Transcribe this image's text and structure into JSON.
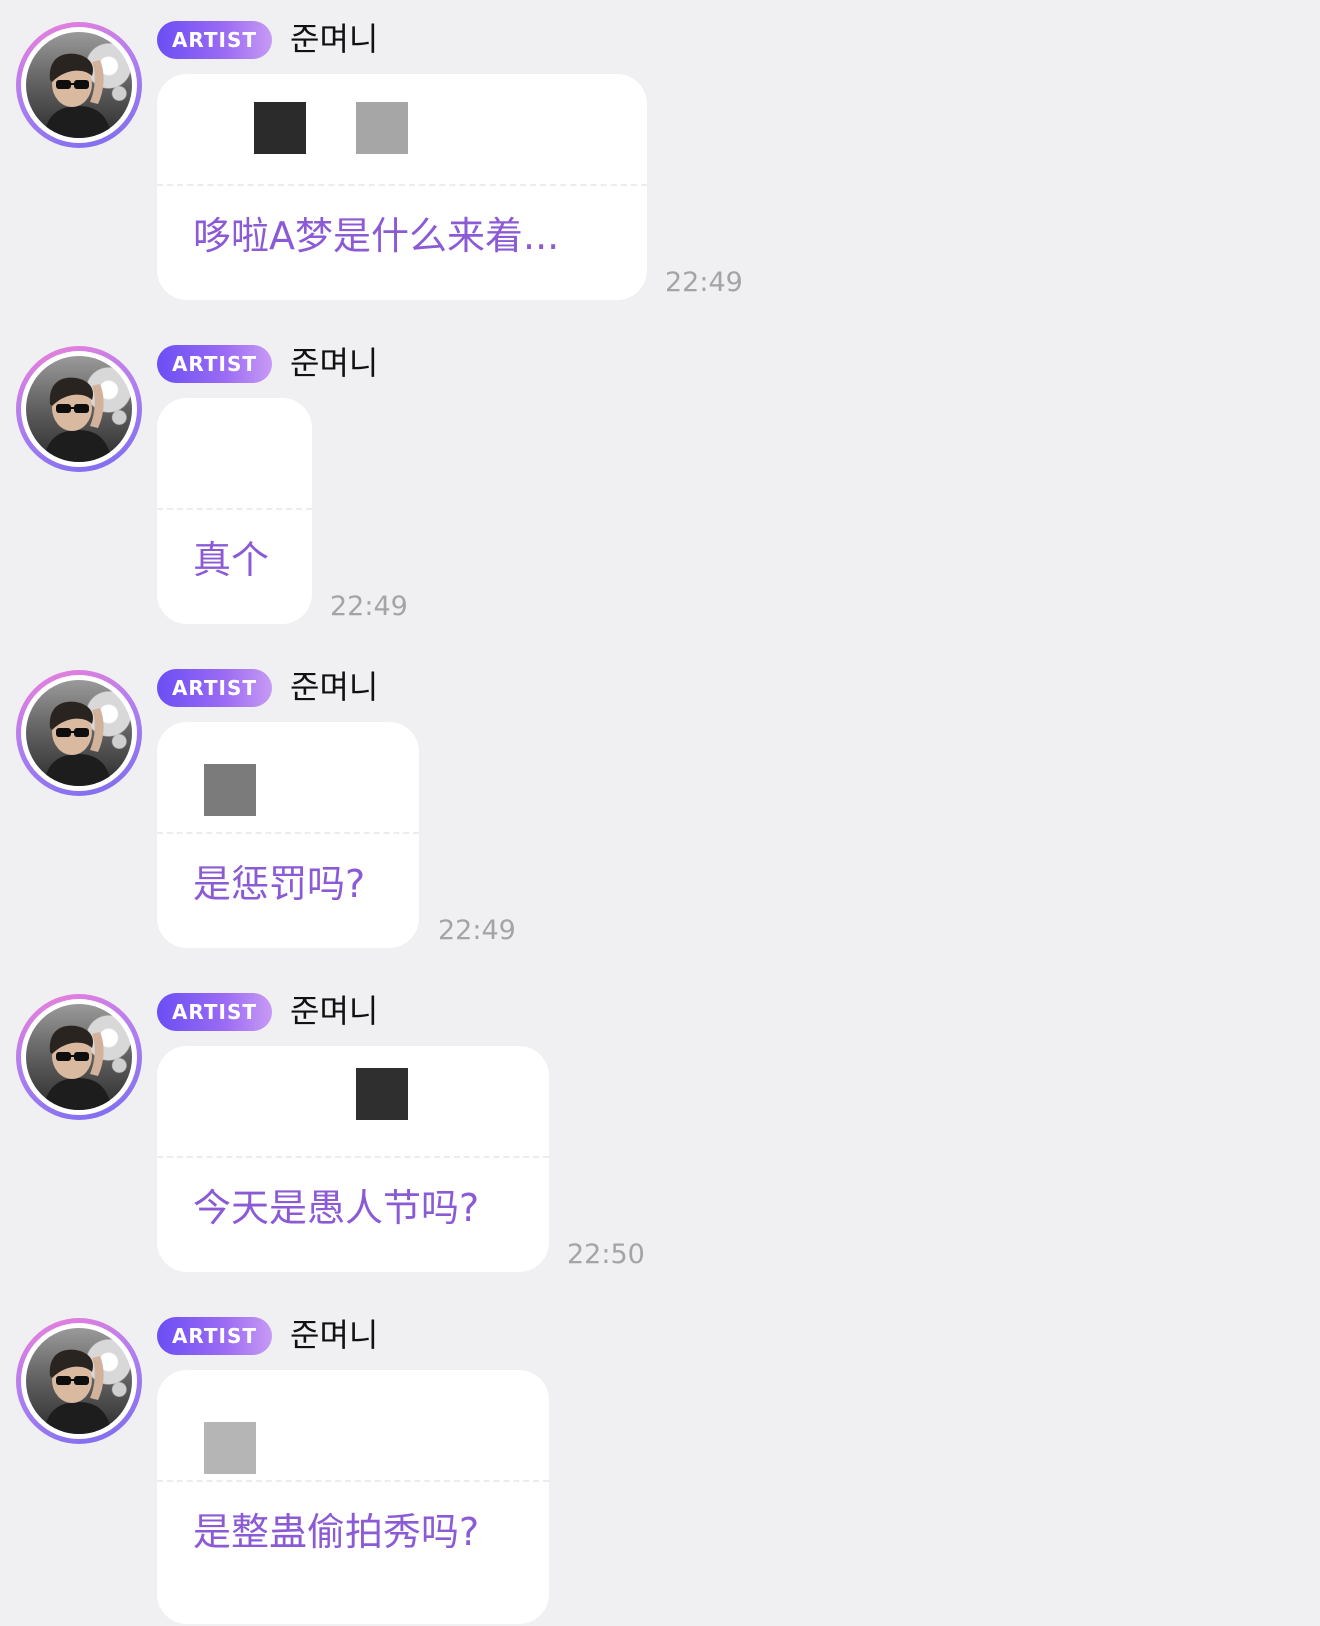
{
  "messages": [
    {
      "badge": "ARTIST",
      "sender": "준며니",
      "text": "哆啦A梦是什么来着...",
      "time": "22:49",
      "redactions": [
        "#2b2b2b",
        "#a6a6a6"
      ]
    },
    {
      "badge": "ARTIST",
      "sender": "준며니",
      "text": "真个",
      "time": "22:49",
      "redactions": []
    },
    {
      "badge": "ARTIST",
      "sender": "준며니",
      "text": "是惩罚吗?",
      "time": "22:49",
      "redactions": [
        "#7b7b7b"
      ]
    },
    {
      "badge": "ARTIST",
      "sender": "준며니",
      "text": "今天是愚人节吗?",
      "time": "22:50",
      "redactions": [
        "#2f2f2f"
      ]
    },
    {
      "badge": "ARTIST",
      "sender": "준며니",
      "text": "是整蛊偷拍秀吗?",
      "time": "",
      "redactions": [
        "#b5b5b5"
      ]
    }
  ],
  "colors": {
    "background": "#f0f0f2",
    "bubble": "#ffffff",
    "message_text": "#8b5bd6",
    "badge_start": "#6b4ef5",
    "badge_end": "#c79af5",
    "timestamp": "#a4a4a4"
  },
  "icons": {
    "avatar": "profile-photo-man-sunglasses"
  }
}
